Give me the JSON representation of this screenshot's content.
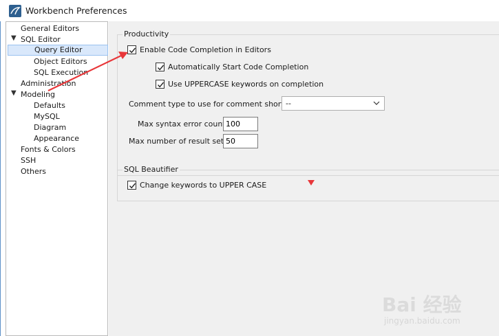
{
  "window": {
    "title": "Workbench Preferences"
  },
  "sidebar": {
    "items": [
      {
        "label": "General Editors"
      },
      {
        "label": "SQL Editor"
      },
      {
        "label": "Query Editor"
      },
      {
        "label": "Object Editors"
      },
      {
        "label": "SQL Execution"
      },
      {
        "label": "Administration"
      },
      {
        "label": "Modeling"
      },
      {
        "label": "Defaults"
      },
      {
        "label": "MySQL"
      },
      {
        "label": "Diagram"
      },
      {
        "label": "Appearance"
      },
      {
        "label": "Fonts & Colors"
      },
      {
        "label": "SSH"
      },
      {
        "label": "Others"
      }
    ],
    "selected": "Query Editor"
  },
  "productivity": {
    "title": "Productivity",
    "enable_code_completion": {
      "label": "Enable Code Completion in Editors",
      "checked": true
    },
    "auto_start_completion": {
      "label": "Automatically Start Code Completion",
      "checked": true
    },
    "uppercase_keywords": {
      "label": "Use UPPERCASE keywords on completion",
      "checked": true
    },
    "comment_type": {
      "label": "Comment type to use for comment shortcut:",
      "value": "--"
    },
    "max_syntax_errors": {
      "label": "Max syntax error count:",
      "value": "100"
    },
    "max_result_sets": {
      "label": "Max number of result sets:",
      "value": "50"
    }
  },
  "beautifier": {
    "title": "SQL Beautifier",
    "change_keywords_upper": {
      "label": "Change keywords to UPPER CASE",
      "checked": true
    }
  },
  "watermark": {
    "brand": "Bai 经验",
    "url": "jingyan.baidu.com"
  },
  "colors": {
    "annotation": "#e8373a",
    "selection": "#d9e8fb",
    "window_border": "#5b8fc7"
  }
}
